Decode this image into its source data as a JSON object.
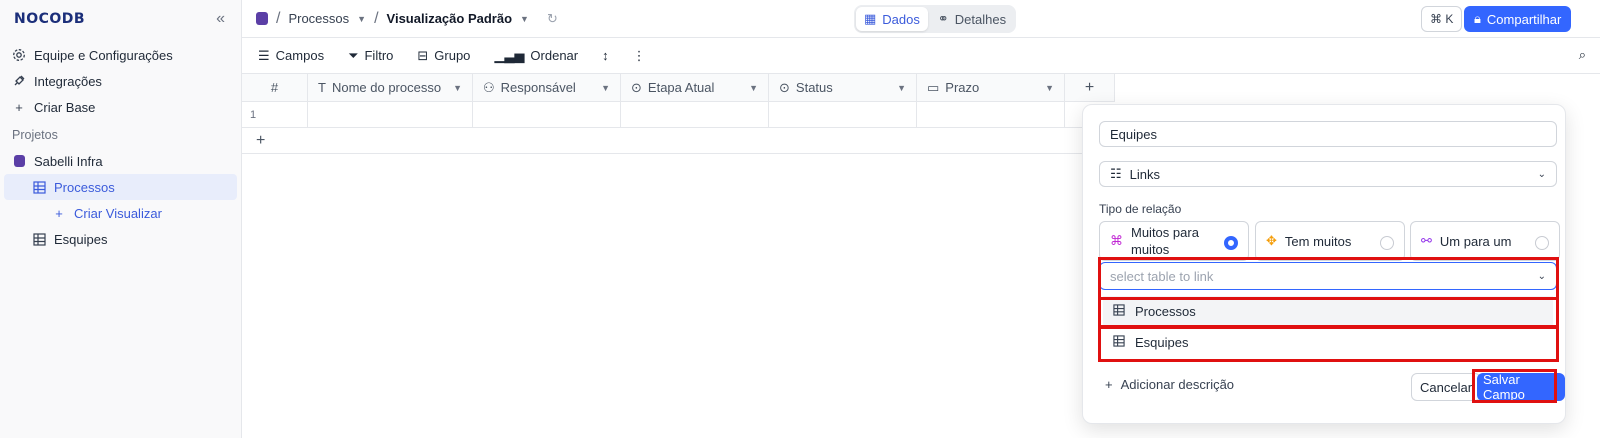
{
  "sidebar": {
    "logo": "NOCODB",
    "collapse_icon": "«",
    "items": [
      {
        "label": "Equipe e Configurações",
        "icon": "gear-icon"
      },
      {
        "label": "Integrações",
        "icon": "plug-icon"
      },
      {
        "label": "Criar Base",
        "icon": "plus-icon"
      }
    ],
    "section_label": "Projetos",
    "project": {
      "label": "Sabelli Infra"
    },
    "tables": [
      {
        "label": "Processos",
        "active": true
      },
      {
        "label": "Criar Visualizar"
      },
      {
        "label": "Esquipes"
      }
    ]
  },
  "topbar": {
    "breadcrumb_table": "Processos",
    "breadcrumb_view": "Visualização Padrão",
    "tabs": [
      {
        "label": "Dados"
      },
      {
        "label": "Detalhes"
      }
    ],
    "shortcut": "⌘ K",
    "share_label": "Compartilhar"
  },
  "toolbar": {
    "fields": "Campos",
    "filter": "Filtro",
    "group": "Grupo",
    "sort": "Ordenar"
  },
  "grid": {
    "columns": [
      {
        "label": "#"
      },
      {
        "label": "Nome do processo"
      },
      {
        "label": "Responsável"
      },
      {
        "label": "Etapa Atual"
      },
      {
        "label": "Status"
      },
      {
        "label": "Prazo"
      }
    ],
    "rows": [
      {
        "index": "1"
      }
    ],
    "add_column": "+",
    "add_row": "+"
  },
  "field_dialog": {
    "name_value": "Equipes",
    "type_value": "Links",
    "relation_label": "Tipo de relação",
    "relation_options": [
      {
        "label": "Muitos para muitos",
        "selected": true
      },
      {
        "label": "Tem muitos",
        "selected": false
      },
      {
        "label": "Um para um",
        "selected": false
      }
    ],
    "table_placeholder": "select table to link",
    "table_options": [
      {
        "label": "Processos"
      },
      {
        "label": "Esquipes"
      }
    ],
    "add_description": "Adicionar descrição",
    "cancel": "Cancelar",
    "save": "Salvar Campo"
  },
  "colors": {
    "accent": "#3366ff",
    "highlight": "#e01010"
  }
}
